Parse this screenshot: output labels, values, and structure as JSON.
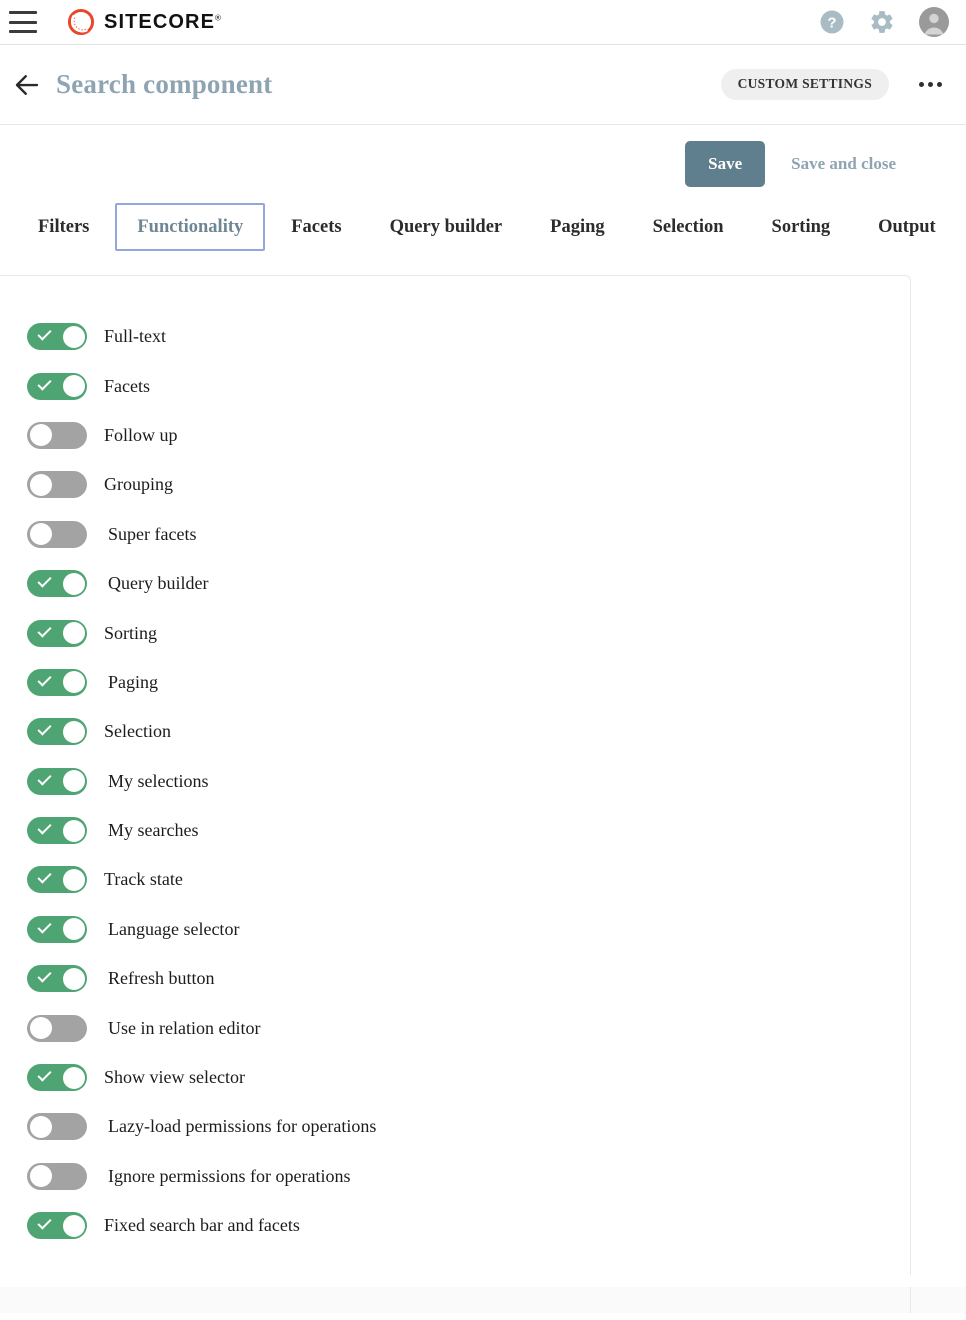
{
  "appbar": {
    "menu_icon": "hamburger-menu-icon",
    "brand_name": "SITECORE",
    "brand_trademark": "®",
    "help_icon": "help-circle-icon",
    "settings_icon": "gear-icon",
    "avatar_icon": "user-avatar-icon"
  },
  "pagehead": {
    "back_icon": "back-arrow-icon",
    "title": "Search component",
    "custom_settings_label": "CUSTOM SETTINGS",
    "more_icon": "ellipsis-horizontal-icon"
  },
  "actions": {
    "save_label": "Save",
    "save_and_close_label": "Save and close"
  },
  "tabs": [
    {
      "label": "Filters",
      "active": false
    },
    {
      "label": "Functionality",
      "active": true
    },
    {
      "label": "Facets",
      "active": false
    },
    {
      "label": "Query builder",
      "active": false
    },
    {
      "label": "Paging",
      "active": false
    },
    {
      "label": "Selection",
      "active": false
    },
    {
      "label": "Sorting",
      "active": false
    },
    {
      "label": "Output",
      "active": false
    }
  ],
  "settings": [
    {
      "label": "Full-text",
      "on": true,
      "indent": false
    },
    {
      "label": "Facets",
      "on": true,
      "indent": false
    },
    {
      "label": "Follow up",
      "on": false,
      "indent": false
    },
    {
      "label": "Grouping",
      "on": false,
      "indent": false
    },
    {
      "label": "Super facets",
      "on": false,
      "indent": true
    },
    {
      "label": "Query builder",
      "on": true,
      "indent": true
    },
    {
      "label": "Sorting",
      "on": true,
      "indent": false
    },
    {
      "label": "Paging",
      "on": true,
      "indent": true
    },
    {
      "label": "Selection",
      "on": true,
      "indent": false
    },
    {
      "label": "My selections",
      "on": true,
      "indent": true
    },
    {
      "label": "My searches",
      "on": true,
      "indent": true
    },
    {
      "label": "Track state",
      "on": true,
      "indent": false
    },
    {
      "label": "Language selector",
      "on": true,
      "indent": true
    },
    {
      "label": "Refresh button",
      "on": true,
      "indent": true
    },
    {
      "label": "Use in relation editor",
      "on": false,
      "indent": true
    },
    {
      "label": "Show view selector",
      "on": true,
      "indent": false
    },
    {
      "label": "Lazy-load permissions for operations",
      "on": false,
      "indent": true
    },
    {
      "label": "Ignore permissions for operations",
      "on": false,
      "indent": true
    },
    {
      "label": "Fixed search bar and facets",
      "on": true,
      "indent": false
    }
  ],
  "colors": {
    "brand_red": "#e8472a",
    "toggle_on": "#4fa473",
    "toggle_off": "#a3a3a3",
    "save_button": "#5f7f8e",
    "title_slate": "#8fa4b2",
    "active_tab_border": "#94a6dd"
  }
}
